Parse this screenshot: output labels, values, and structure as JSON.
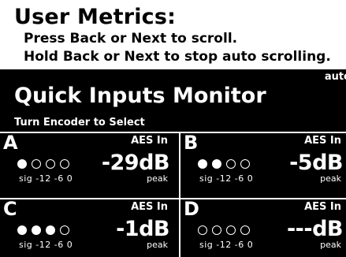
{
  "header": {
    "title": "User Metrics:",
    "line1": "Press Back or Next to scroll.",
    "line2": "Hold Back or Next to stop auto scrolling."
  },
  "screen": {
    "status": "auto",
    "title": "Quick Inputs Monitor",
    "hint": "Turn Encoder to Select"
  },
  "channels": [
    {
      "letter": "A",
      "source": "AES In",
      "value": "-29dB",
      "scale": "sig -12 -6  0",
      "peak_label": "peak",
      "level_dots_filled": 1,
      "level_dots_total": 4
    },
    {
      "letter": "B",
      "source": "AES In",
      "value": "-5dB",
      "scale": "sig -12 -6  0",
      "peak_label": "peak",
      "level_dots_filled": 2,
      "level_dots_total": 4
    },
    {
      "letter": "C",
      "source": "AES In",
      "value": "-1dB",
      "scale": "sig -12 -6  0",
      "peak_label": "peak",
      "level_dots_filled": 3,
      "level_dots_total": 4
    },
    {
      "letter": "D",
      "source": "AES In",
      "value": "---dB",
      "scale": "sig -12 -6  0",
      "peak_label": "peak",
      "level_dots_filled": 0,
      "level_dots_total": 4
    }
  ]
}
